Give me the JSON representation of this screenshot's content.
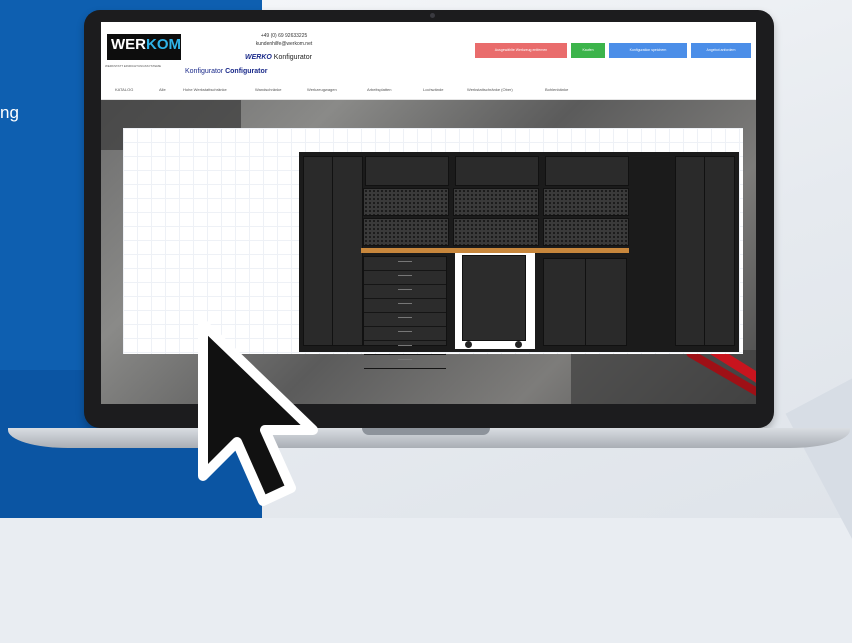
{
  "side_text": "ng",
  "site": {
    "logo_a": "WER",
    "logo_b": "KOM",
    "logo_sub": "WERKSTATT EINRICHTUNGSSYSTEME",
    "contact_phone": "+49 (0) 69 92633225",
    "contact_email": "kundenhilfe@werkom.net",
    "configurator_brand": "WERKO",
    "configurator_label": "Konfigurator",
    "tagline_prefix": "Konfigurator",
    "tagline_strong": "Configurator",
    "buttons": [
      "Ausgewählte Werkzeug entfernen",
      "Kaufen",
      "Konfiguration speichern",
      "Angebot anfordern"
    ],
    "nav": [
      "KATALOG",
      "Alle",
      "Hohe Werkstattschränke",
      "Wandschränke",
      "Werkzeugwagen",
      "Arbeitsplatten",
      "Lochwände",
      "Werkstattschränke (Ober)",
      "Bohlenbänke"
    ]
  },
  "colors": {
    "accent_blue": "#4b8ee8",
    "accent_red": "#e96c6c",
    "accent_green": "#3cb44b",
    "background_blue": "#0e5fb0"
  },
  "icons": [
    "mouse-pointer-icon"
  ]
}
